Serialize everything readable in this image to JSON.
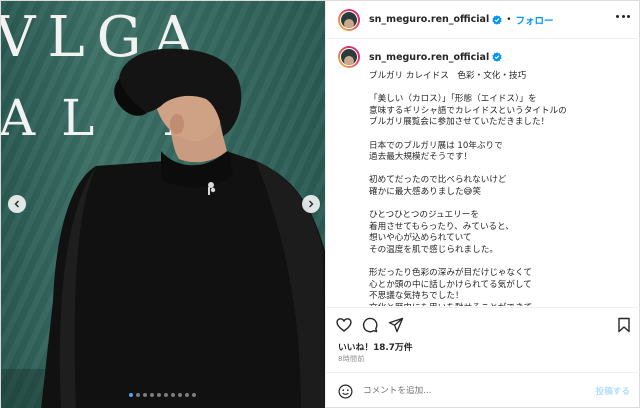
{
  "media": {
    "backdrop_line1": "VLGA",
    "backdrop_line2": "AL D",
    "slide_count": 10,
    "active_slide": 1
  },
  "header": {
    "username": "sn_meguro.ren_official",
    "separator": "•",
    "follow_label": "フォロー"
  },
  "caption": {
    "username": "sn_meguro.ren_official",
    "paragraphs": [
      [
        "ブルガリ カレイドス　色彩・文化・技巧"
      ],
      [
        "「美しい（カロス）」「形態（エイドス）」を",
        "意味するギリシャ語でカレイドスというタイトルの",
        "ブルガリ展覧会に参加させていただきました！"
      ],
      [
        "日本でのブルガリ展は 10年ぶりで",
        "過去最大規模だそうです！"
      ],
      [
        "初めてだったので比べられないけど",
        "確かに最大感ありました😅笑"
      ],
      [
        "ひとつひとつのジュエリーを",
        "着用させてもらったり、みていると、",
        "想いや心が込められていて",
        "その温度を肌で感じられました。"
      ],
      [
        "形だったり色彩の深みが目だけじゃなくて",
        "心とか頭の中に話しかけられてる気がして",
        "不思議な気持ちでした！",
        "文化と歴史にも思いを馳せることができて"
      ]
    ]
  },
  "actions": {
    "likes": "いいね！18.7万件",
    "time": "8時間前"
  },
  "comment": {
    "placeholder": "コメントを追加...",
    "post_label": "投稿する"
  },
  "colors": {
    "accent": "#0095f6",
    "post_disabled": "#b2dffc",
    "backdrop": "#356960",
    "text": "#262626",
    "muted": "#8e8e8e"
  },
  "icons": {
    "verified": "verified-badge-icon",
    "more": "more-options-icon",
    "like": "heart-icon",
    "comment": "comment-icon",
    "share": "share-icon",
    "save": "bookmark-icon",
    "emoji": "emoji-icon",
    "prev": "chevron-left-icon",
    "next": "chevron-right-icon"
  }
}
